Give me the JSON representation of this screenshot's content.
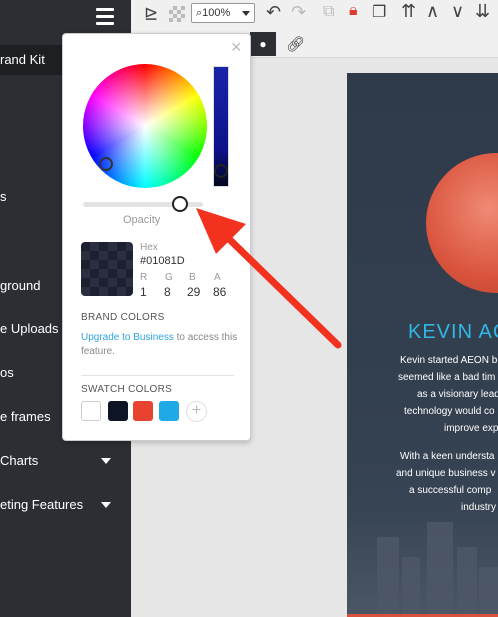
{
  "sidebar": {
    "items": [
      {
        "label": "rand Kit",
        "active": true
      },
      {
        "label": "s"
      },
      {
        "label": "ground"
      },
      {
        "label": "e Uploads"
      },
      {
        "label": "os"
      },
      {
        "label": "e frames"
      },
      {
        "label": "Charts",
        "has_caret": true
      },
      {
        "label": "eting Features",
        "has_caret": true
      }
    ]
  },
  "toolbar": {
    "zoom": "100%"
  },
  "picker": {
    "close_label": "×",
    "opacity_label": "Opacity",
    "opacity_value": 0.86,
    "hex_label": "Hex",
    "hex_value": "#01081D",
    "channels": [
      {
        "label": "R",
        "value": "1"
      },
      {
        "label": "G",
        "value": "8"
      },
      {
        "label": "B",
        "value": "29"
      },
      {
        "label": "A",
        "value": "86"
      }
    ],
    "brand_colors_title": "BRAND COLORS",
    "upgrade_link": "Upgrade to Business",
    "upgrade_rest": " to access this feature.",
    "swatch_colors_title": "SWATCH COLORS",
    "swatches": [
      "#ffffff",
      "#0d1424",
      "#e8432f",
      "#1fa9e6"
    ],
    "add_label": "+"
  },
  "design": {
    "name": "KEVIN AC",
    "bio_lines": [
      "Kevin started AEON b",
      "seemed like a bad tim",
      "as a visionary lead",
      "technology would co",
      "improve exp",
      "",
      "With a keen understa",
      "and unique business v",
      "a successful comp",
      "industry"
    ]
  }
}
